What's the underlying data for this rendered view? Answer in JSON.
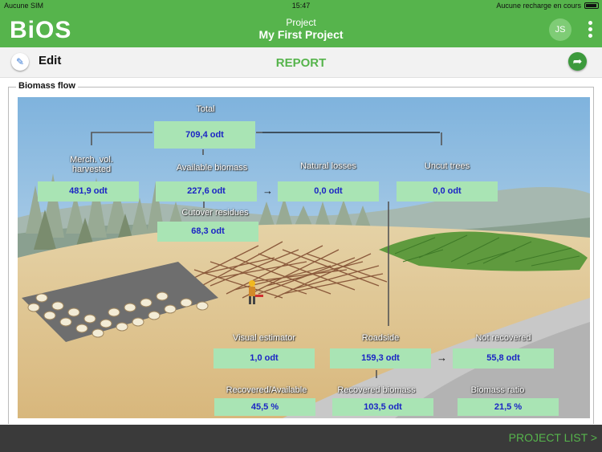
{
  "status": {
    "carrier": "Aucune SIM",
    "time": "15:47",
    "battery": "Aucune recharge en cours"
  },
  "app": {
    "logo": "BiOS",
    "project_label": "Project",
    "project_name": "My First Project",
    "avatar": "JS"
  },
  "toolbar": {
    "edit_label": "Edit",
    "report_label": "REPORT"
  },
  "section": {
    "title": "Biomass flow"
  },
  "flow": {
    "total": {
      "label": "Total",
      "value": "709,4 odt"
    },
    "merch": {
      "label": "Merch. vol. harvested",
      "value": "481,9 odt"
    },
    "available": {
      "label": "Available biomass",
      "value": "227,6 odt"
    },
    "natural": {
      "label": "Natural losses",
      "value": "0,0 odt"
    },
    "uncut": {
      "label": "Uncut trees",
      "value": "0,0 odt"
    },
    "cutover": {
      "label": "Cutover residues",
      "value": "68,3 odt"
    },
    "visual": {
      "label": "Visual estimator",
      "value": "1,0 odt"
    },
    "roadside": {
      "label": "Roadside",
      "value": "159,3 odt"
    },
    "notrec": {
      "label": "Not recovered",
      "value": "55,8 odt"
    },
    "recavail": {
      "label": "Recovered/Available",
      "value": "45,5 %"
    },
    "recbio": {
      "label": "Recovered biomass",
      "value": "103,5 odt"
    },
    "ratio": {
      "label": "Biomass ratio",
      "value": "21,5 %"
    }
  },
  "footer": {
    "project_list": "PROJECT LIST >"
  },
  "colors": {
    "brand": "#56b44c",
    "value_bg": "#a9e4b4",
    "value_text": "#1b24c5"
  }
}
